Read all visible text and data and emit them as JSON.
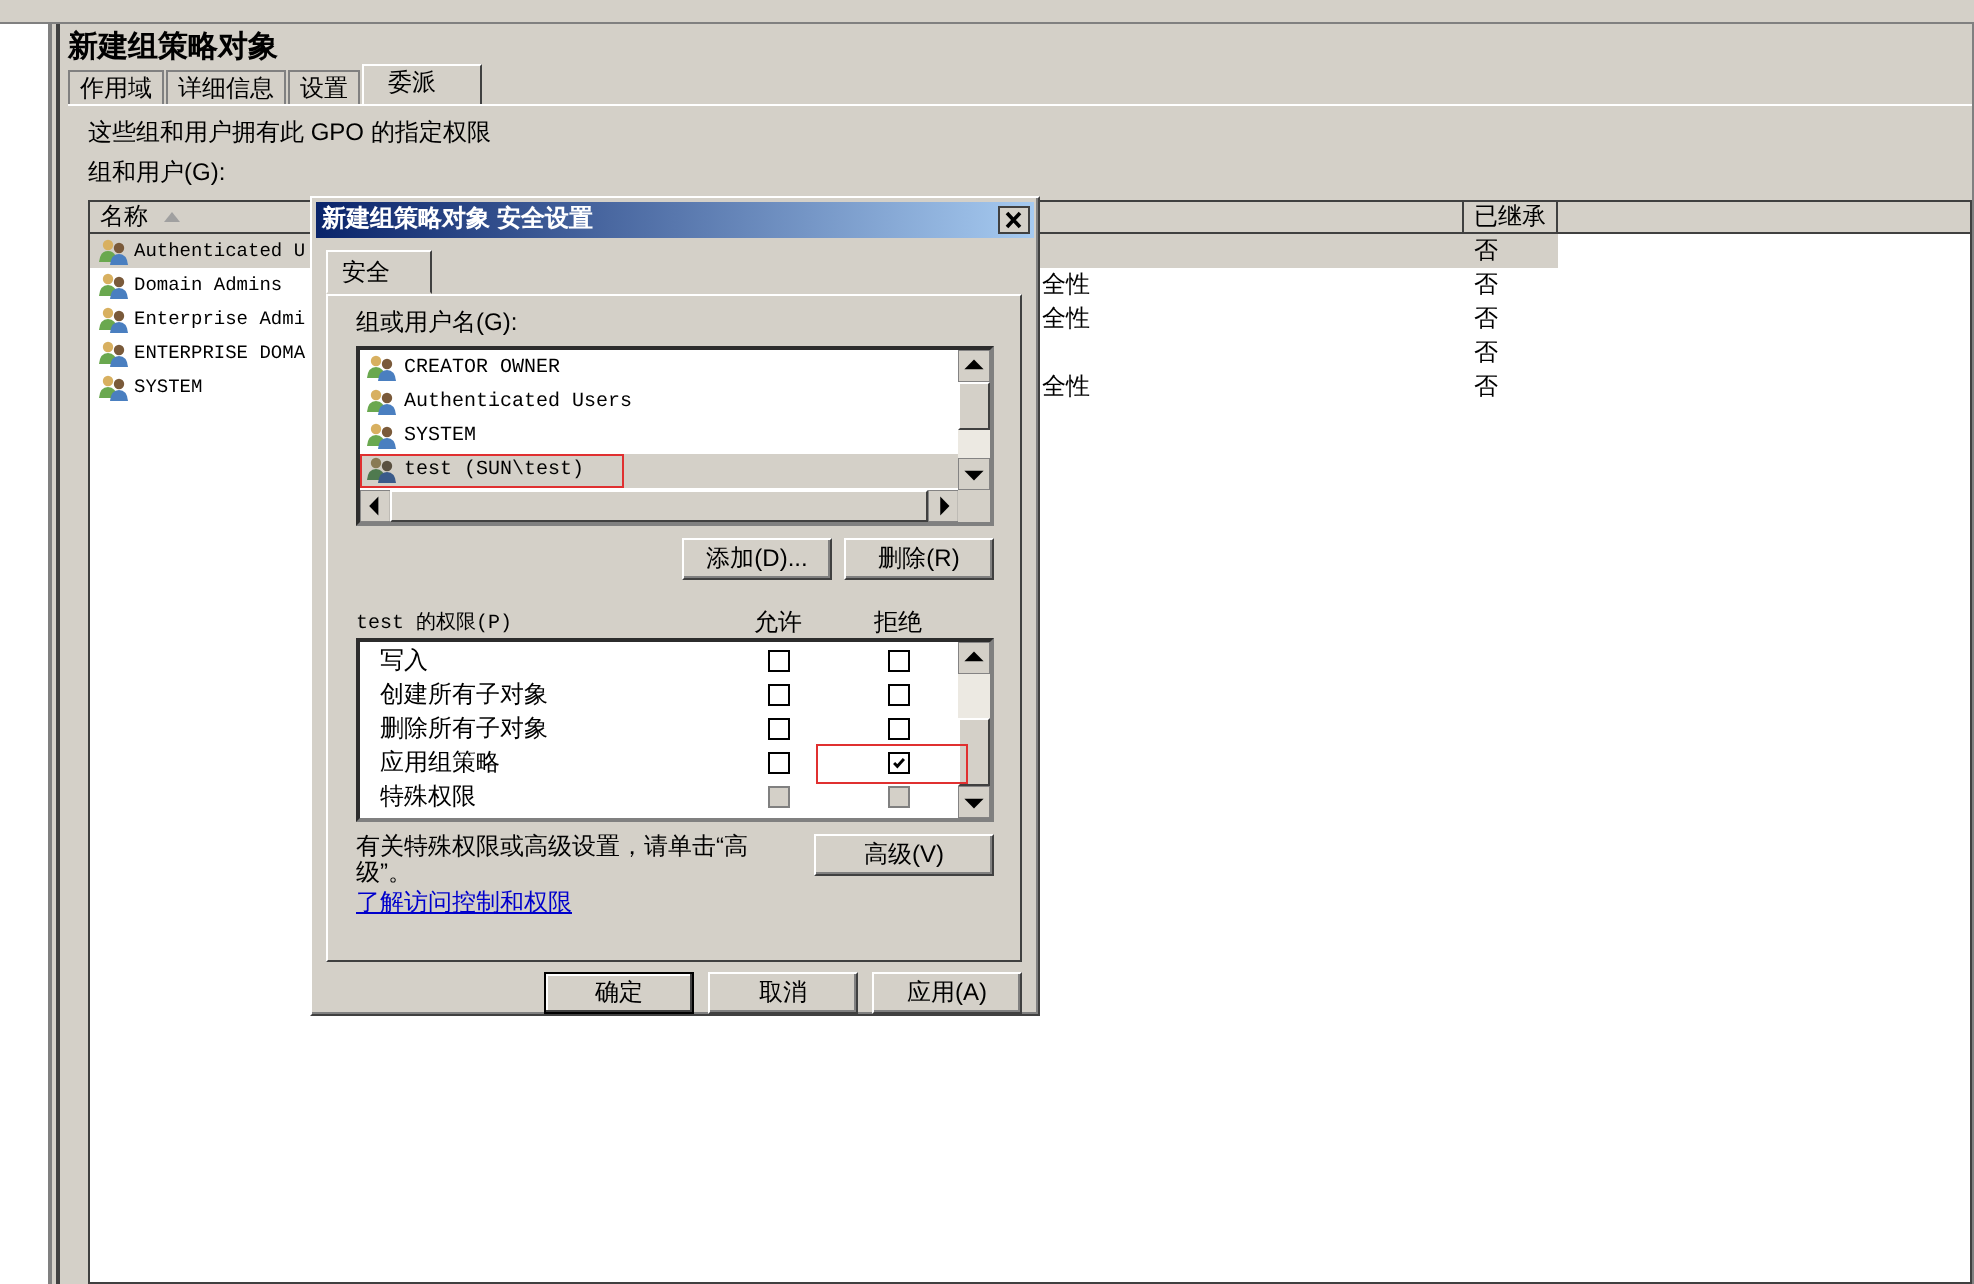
{
  "window": {
    "title": "新建组策略对象"
  },
  "tabs": [
    {
      "label": "作用域",
      "selected": false
    },
    {
      "label": "详细信息",
      "selected": false
    },
    {
      "label": "设置",
      "selected": false
    },
    {
      "label": "委派",
      "selected": true
    }
  ],
  "description": "这些组和用户拥有此 GPO 的指定权限",
  "groups_label": "组和用户(G):",
  "table": {
    "columns": [
      "名称",
      "已继承"
    ],
    "rows": [
      {
        "name": "Authenticated U",
        "inherited": "否",
        "selected": true
      },
      {
        "name": "Domain Admins",
        "column_2": "全性",
        "inherited": "否",
        "selected": false
      },
      {
        "name": "Enterprise Admi",
        "column_2": "全性",
        "inherited": "否",
        "selected": false
      },
      {
        "name": "ENTERPRISE DOMA",
        "inherited": "否",
        "selected": false
      },
      {
        "name": "SYSTEM",
        "column_2": "全性",
        "inherited": "否",
        "selected": false
      }
    ]
  },
  "dialog": {
    "title": "新建组策略对象 安全设置",
    "tabs": [
      {
        "label": "安全",
        "selected": true
      }
    ],
    "users_label": "组或用户名(G):",
    "users": [
      {
        "name": "CREATOR OWNER",
        "selected": false
      },
      {
        "name": "Authenticated Users",
        "selected": false
      },
      {
        "name": "SYSTEM",
        "selected": false
      },
      {
        "name": "test (SUN\\test)",
        "selected": true
      }
    ],
    "user_buttons": [
      "添加(D)...",
      "删除(R)"
    ],
    "permissions_label": "test 的权限(P)",
    "allow_label": "允许",
    "deny_label": "拒绝",
    "permissions": [
      {
        "name": "写入",
        "allow": false,
        "deny": false,
        "disabled": false
      },
      {
        "name": "创建所有子对象",
        "allow": false,
        "deny": false,
        "disabled": false
      },
      {
        "name": "删除所有子对象",
        "allow": false,
        "deny": false,
        "disabled": false
      },
      {
        "name": "应用组策略",
        "allow": false,
        "deny": true,
        "disabled": false
      },
      {
        "name": "特殊权限",
        "allow": false,
        "deny": false,
        "disabled": true
      }
    ],
    "advanced_hint": "有关特殊权限或高级设置，请单击“高级”。",
    "advanced_button": "高级(V)",
    "link": "了解访问控制和权限",
    "footer_buttons": [
      {
        "label": "确定",
        "default": true
      },
      {
        "label": "取消",
        "default": false
      },
      {
        "label": "应用(A)",
        "default": false
      }
    ]
  }
}
